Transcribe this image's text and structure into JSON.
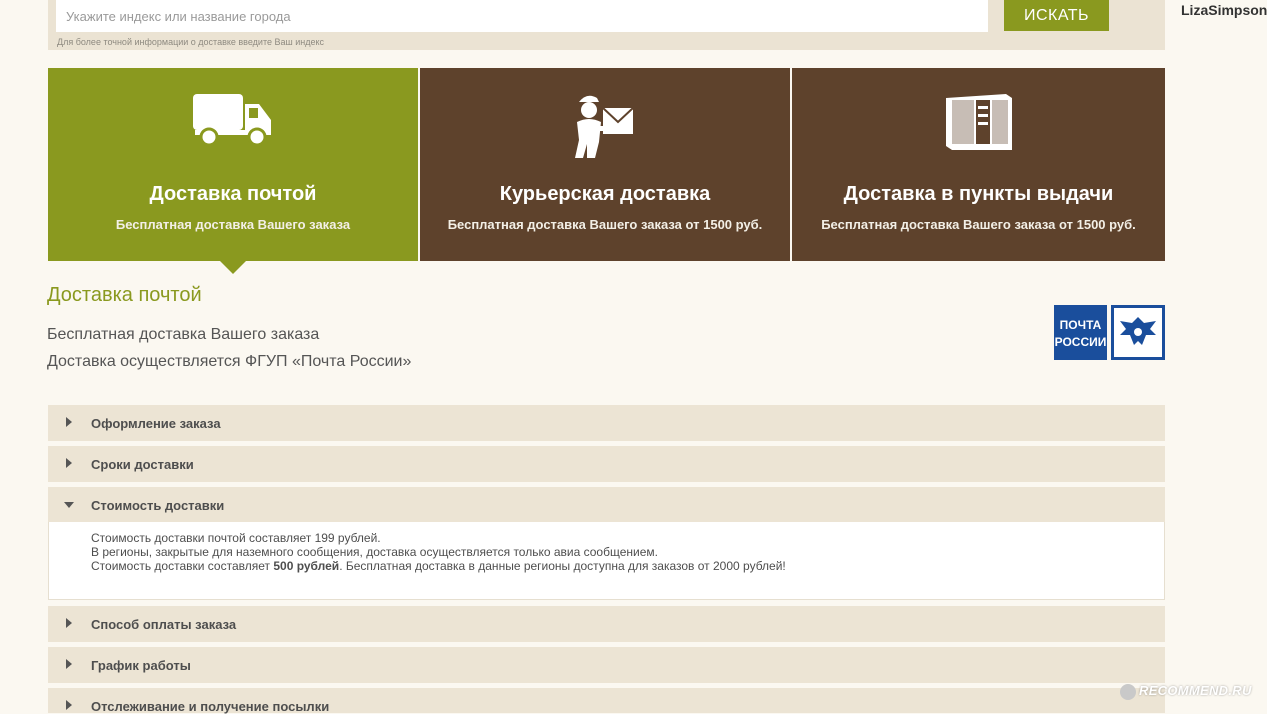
{
  "search": {
    "placeholder": "Укажите индекс или название города",
    "button_label": "ИСКАТЬ",
    "hint": "Для более точной информации о доставке введите Ваш индекс"
  },
  "user": {
    "name": "LizaSimpson"
  },
  "methods": [
    {
      "title": "Доставка почтой",
      "subtitle": "Бесплатная доставка Вашего заказа",
      "icon": "truck-icon",
      "active": true
    },
    {
      "title": "Курьерская доставка",
      "subtitle": "Бесплатная доставка Вашего заказа от 1500 руб.",
      "icon": "courier-icon",
      "active": false
    },
    {
      "title": "Доставка в пункты выдачи",
      "subtitle": "Бесплатная доставка Вашего заказа от 1500 руб.",
      "icon": "locker-icon",
      "active": false
    }
  ],
  "section": {
    "title": "Доставка почтой",
    "line1": "Бесплатная доставка Вашего заказа",
    "line2": "Доставка осуществляется ФГУП «Почта России»",
    "logo_text_1": "ПОЧТА",
    "logo_text_2": "РОССИИ"
  },
  "accordion": [
    {
      "label": "Оформление заказа",
      "open": false
    },
    {
      "label": "Сроки доставки",
      "open": false
    },
    {
      "label": "Стоимость доставки",
      "open": true
    },
    {
      "label": "Способ оплаты заказа",
      "open": false
    },
    {
      "label": "График работы",
      "open": false
    },
    {
      "label": "Отслеживание и получение посылки",
      "open": false
    }
  ],
  "cost_content": {
    "line1": "Стоимость доставки почтой составляет 199 рублей.",
    "line2": "В регионы, закрытые для наземного сообщения, доставка осуществляется только авиа сообщением.",
    "line3_a": "Стоимость доставки составляет ",
    "line3_bold": "500 рублей",
    "line3_b": ". Бесплатная доставка в данные регионы доступна для заказов от 2000 рублей!"
  },
  "watermark": "RECOMMEND.RU",
  "colors": {
    "accent": "#8a991f",
    "brown": "#5e422c",
    "panel": "#ebe3d3",
    "background": "#fbf8f1",
    "post_blue": "#1a4e9c"
  }
}
